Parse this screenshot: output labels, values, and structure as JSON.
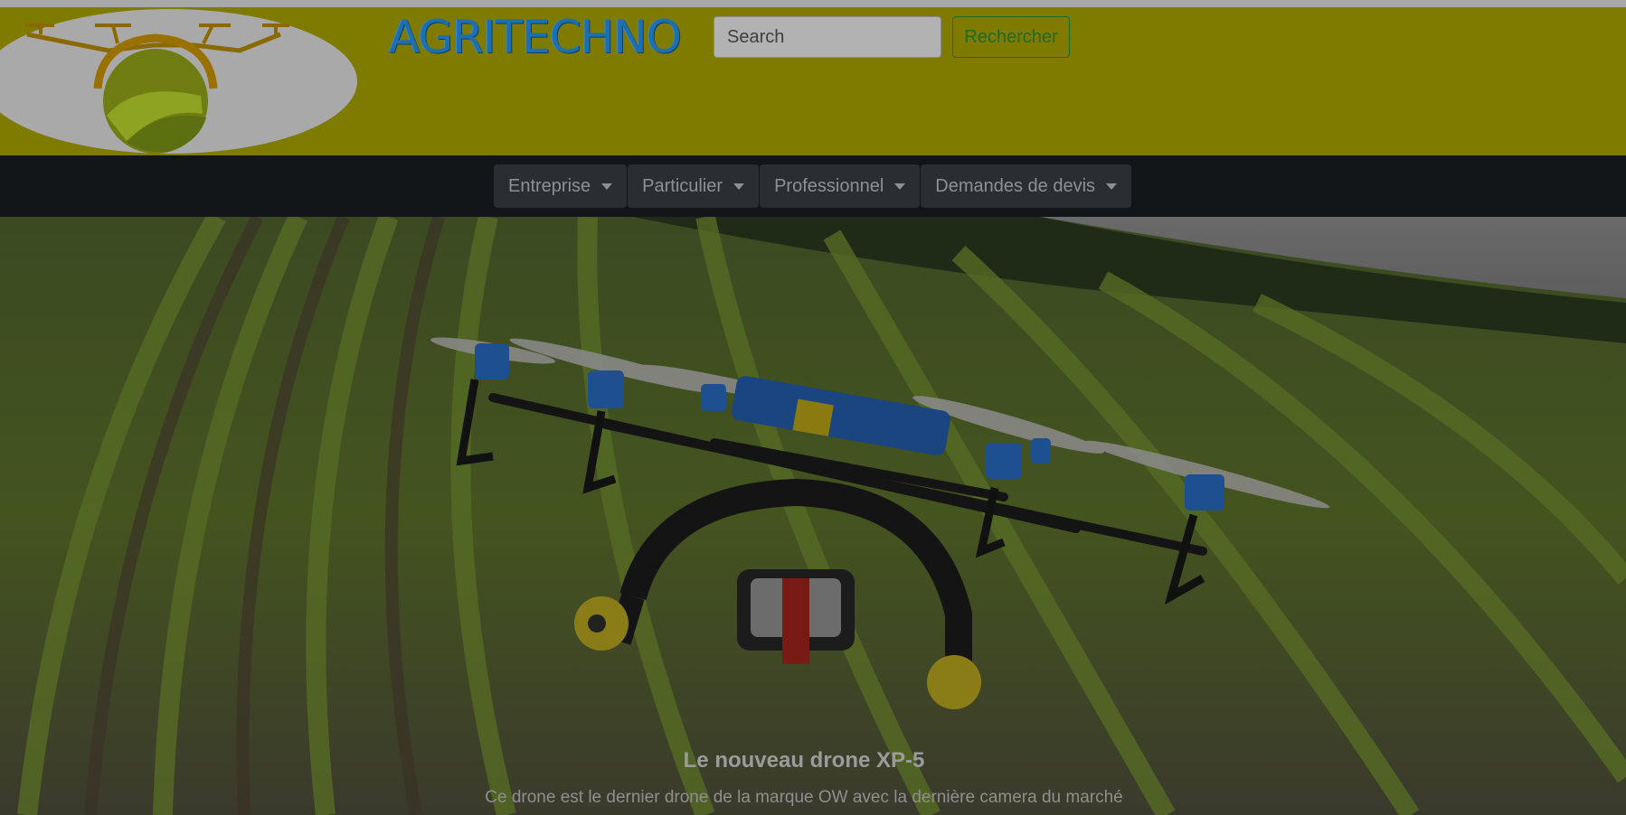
{
  "header": {
    "brand": "AGRITECHNO",
    "search": {
      "placeholder": "Search",
      "button_label": "Rechercher"
    },
    "logo_icon": "drone-field-logo"
  },
  "nav": {
    "items": [
      {
        "label": "Entreprise",
        "icon": "caret-down-icon"
      },
      {
        "label": "Particulier",
        "icon": "caret-down-icon"
      },
      {
        "label": "Professionnel",
        "icon": "caret-down-icon"
      },
      {
        "label": "Demandes de devis",
        "icon": "caret-down-icon"
      }
    ]
  },
  "carousel": {
    "slide": {
      "title": "Le nouveau drone XP-5",
      "text": "Ce drone est le dernier drone de la marque OW avec la dernière camera du marché"
    }
  },
  "colors": {
    "header_bg": "#7f7a00",
    "navbar_bg": "#131619",
    "brand_text": "#1e6fb0",
    "button_green": "#1f6b2a"
  }
}
